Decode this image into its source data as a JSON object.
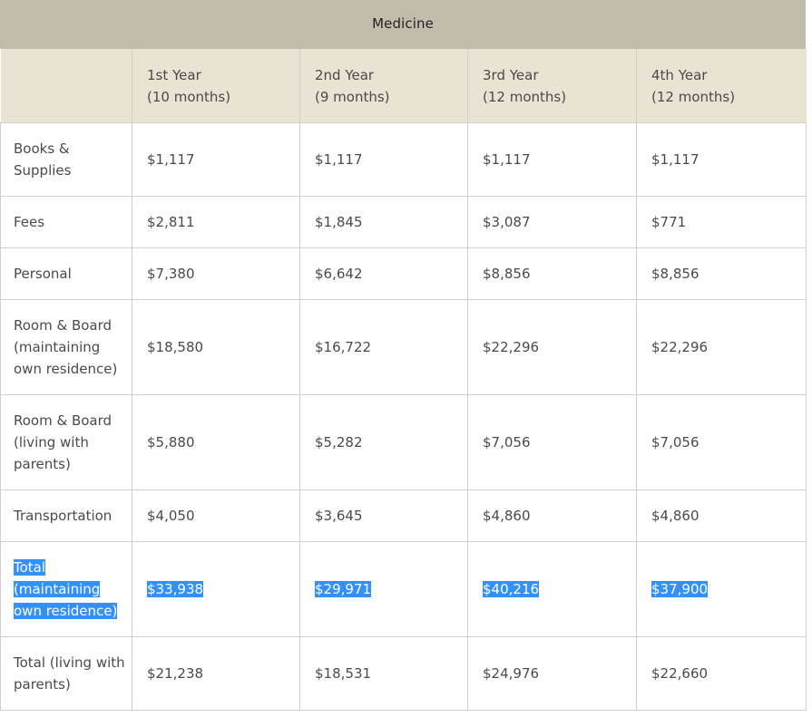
{
  "table": {
    "caption": "Medicine",
    "headers": [
      {
        "line1": "",
        "line2": ""
      },
      {
        "line1": "1st Year",
        "line2": "(10 months)"
      },
      {
        "line1": "2nd Year",
        "line2": "(9 months)"
      },
      {
        "line1": "3rd Year",
        "line2": "(12 months)"
      },
      {
        "line1": "4th Year",
        "line2": "(12 months)"
      }
    ],
    "rows": [
      {
        "label": "Books & Supplies",
        "values": [
          "$1,117",
          "$1,117",
          "$1,117",
          "$1,117"
        ]
      },
      {
        "label": "Fees",
        "values": [
          "$2,811",
          "$1,845",
          "$3,087",
          "$771"
        ]
      },
      {
        "label": "Personal",
        "values": [
          "$7,380",
          "$6,642",
          "$8,856",
          "$8,856"
        ]
      },
      {
        "label": "Room & Board (maintaining own residence)",
        "values": [
          "$18,580",
          "$16,722",
          "$22,296",
          "$22,296"
        ]
      },
      {
        "label": "Room & Board (living with parents)",
        "values": [
          "$5,880",
          "$5,282",
          "$7,056",
          "$7,056"
        ]
      },
      {
        "label": "Transportation",
        "values": [
          "$4,050",
          "$3,645",
          "$4,860",
          "$4,860"
        ]
      },
      {
        "label": "Total (maintaining own residence)",
        "values": [
          "$33,938",
          "$29,971",
          "$40,216",
          "$37,900"
        ],
        "selected": true
      },
      {
        "label": "Total (living with parents)",
        "values": [
          "$21,238",
          "$18,531",
          "$24,976",
          "$22,660"
        ]
      }
    ]
  },
  "colors": {
    "caption_bg": "#c2bcac",
    "header_bg": "#e8e3d3",
    "selection": "#3390ff",
    "text": "#4a4a4a"
  }
}
